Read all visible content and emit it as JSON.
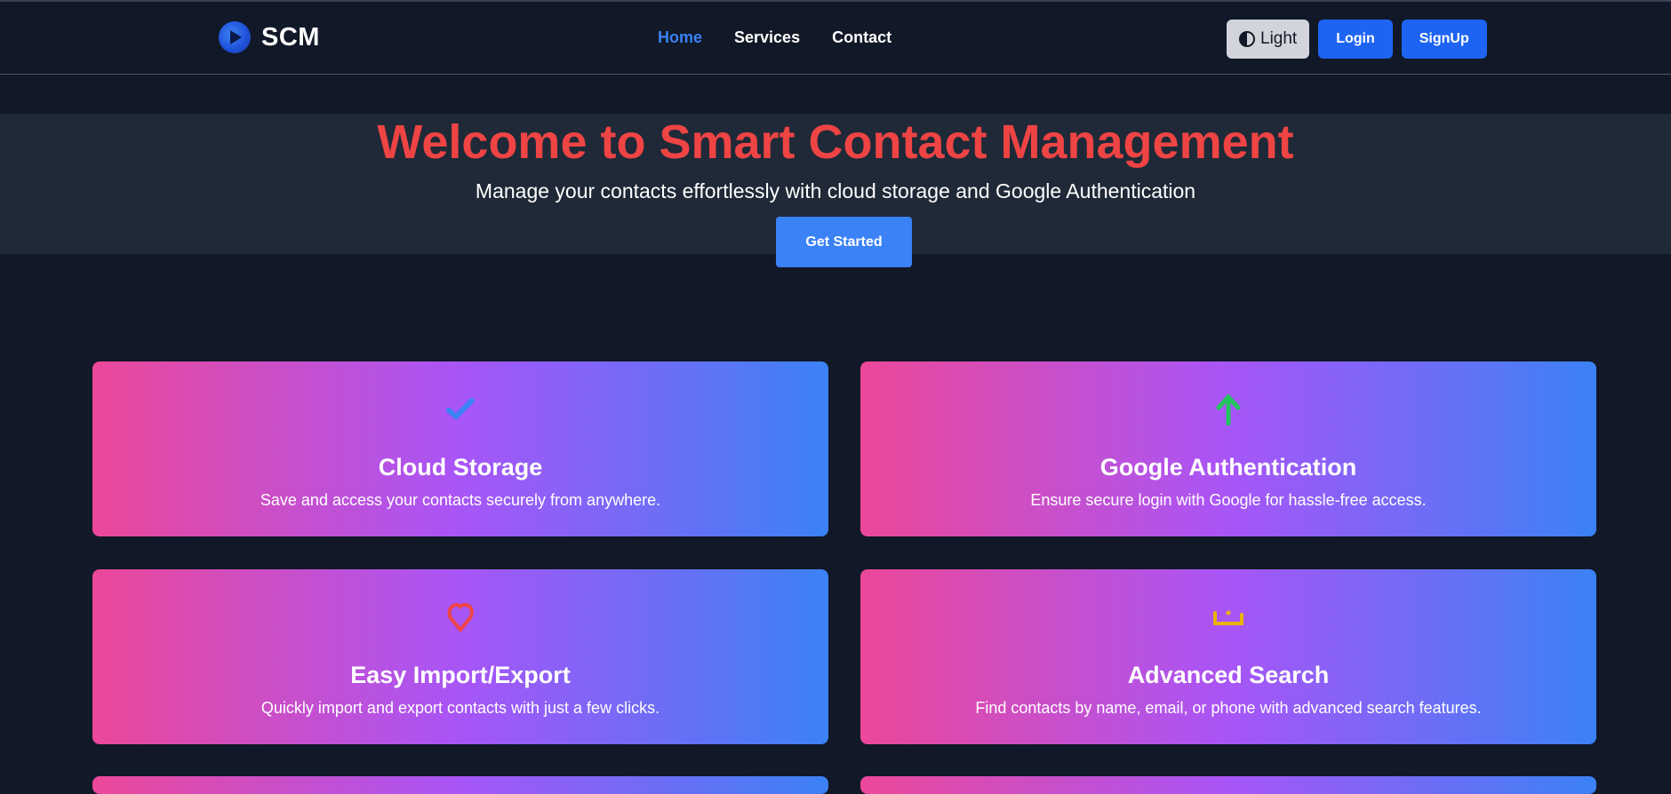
{
  "nav": {
    "brand": "SCM",
    "links": [
      {
        "label": "Home"
      },
      {
        "label": "Services"
      },
      {
        "label": "Contact"
      }
    ],
    "theme_label": "Light",
    "login_label": "Login",
    "signup_label": "SignUp"
  },
  "hero": {
    "title": "Welcome to Smart Contact Management",
    "subtitle": "Manage your contacts effortlessly with cloud storage and Google Authentication",
    "cta_label": "Get Started"
  },
  "features": [
    {
      "icon": "check-icon",
      "icon_glyph": "✔",
      "icon_color": "#3b82f6",
      "title": "Cloud Storage",
      "description": "Save and access your contacts securely from anywhere."
    },
    {
      "icon": "arrow-up-icon",
      "icon_glyph": "↑",
      "icon_color": "#22c55e",
      "title": "Google Authentication",
      "description": "Ensure secure login with Google for hassle-free access."
    },
    {
      "icon": "heart-icon",
      "icon_glyph": "♡",
      "icon_color": "#ef4444",
      "title": "Easy Import/Export",
      "description": "Quickly import and export contacts with just a few clicks."
    },
    {
      "icon": "search-icon",
      "icon_glyph": "ن",
      "icon_color": "#eab308",
      "title": "Advanced Search",
      "description": "Find contacts by name, email, or phone with advanced search features."
    }
  ],
  "colors": {
    "background": "#111827",
    "hero_band": "#1f2937",
    "hero_title": "#ef4444",
    "accent": "#3b82f6",
    "card_gradient": [
      "#ec4899",
      "#a855f7",
      "#3b82f6"
    ]
  }
}
